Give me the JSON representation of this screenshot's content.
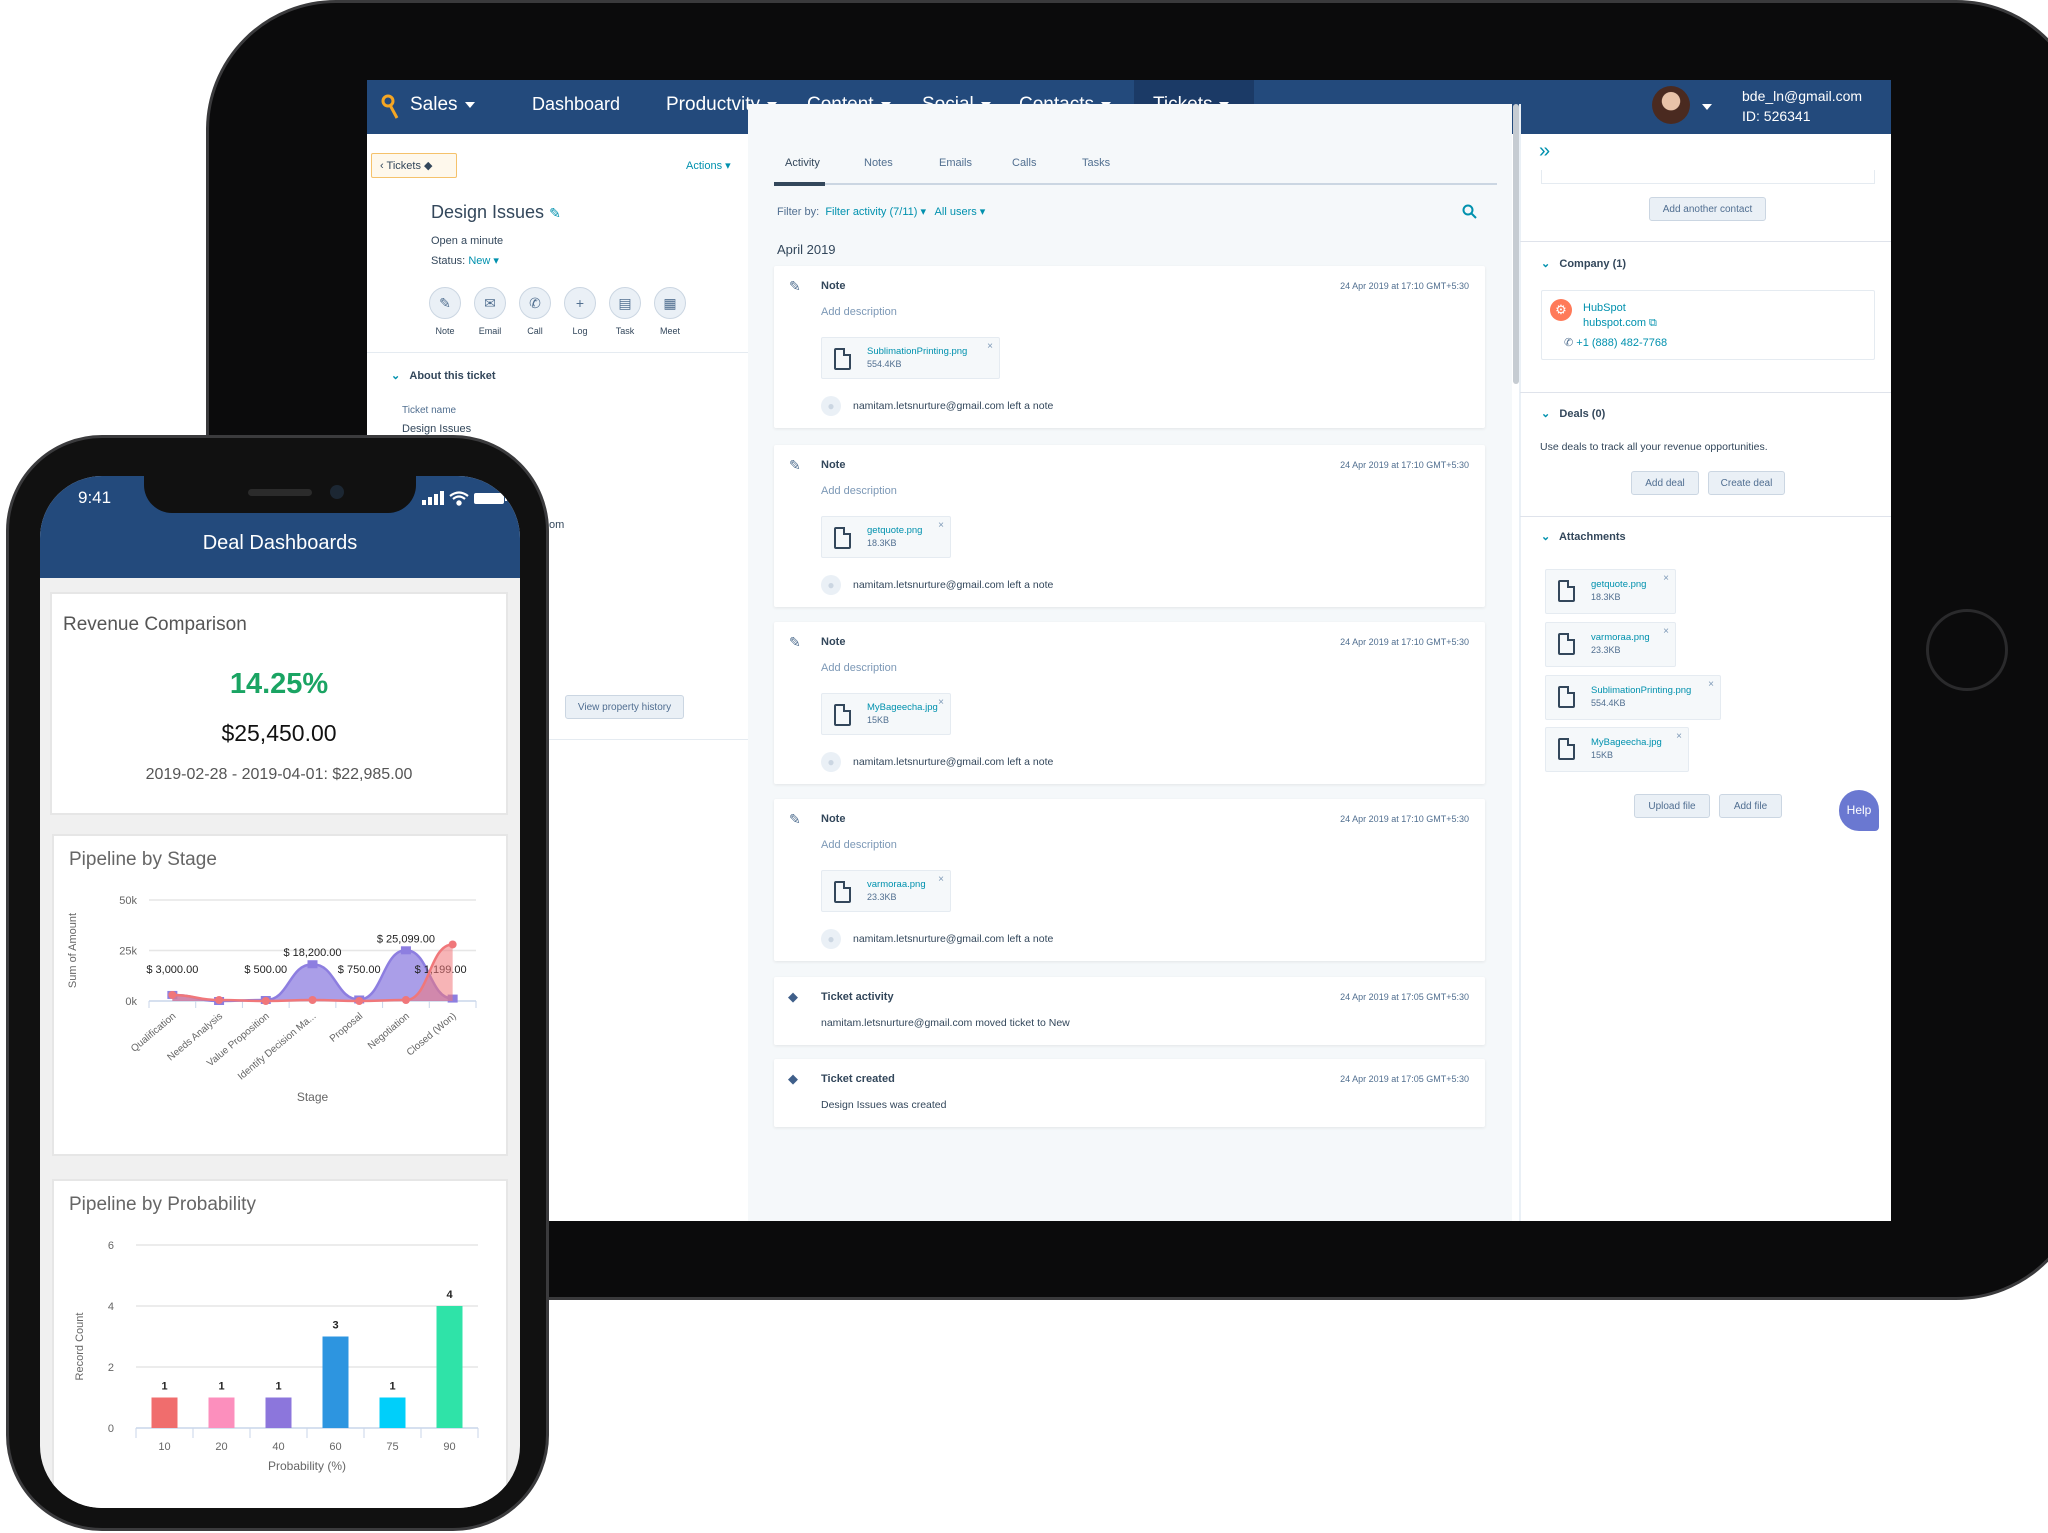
{
  "ipad": {
    "nav": {
      "app": "Sales",
      "items": [
        "Dashboard",
        "Productvity",
        "Content",
        "Social",
        "Contacts",
        "Tickets"
      ],
      "user_email": "bde_ln@gmail.com",
      "user_id": "ID: 526341",
      "brand_color": "#234a7c"
    },
    "left": {
      "breadcrumb": "Tickets",
      "actions": "Actions",
      "title": "Design Issues",
      "open": "Open a minute",
      "status_label": "Status:",
      "status_value": "New",
      "actions_row": [
        "Note",
        "Email",
        "Call",
        "Log",
        "Task",
        "Meet"
      ],
      "about": "About this ticket",
      "ticket_name_label": "Ticket name",
      "ticket_name_value": "Design Issues",
      "fragment": "om",
      "view_history": "View property history"
    },
    "middle": {
      "tabs": [
        "Activity",
        "Notes",
        "Emails",
        "Calls",
        "Tasks"
      ],
      "filter_label": "Filter by:",
      "filter_activity": "Filter activity (7/11)",
      "all_users": "All users",
      "month": "April 2019",
      "notes": [
        {
          "type": "Note",
          "time": "24 Apr 2019 at 17:10 GMT+5:30",
          "desc": "Add description",
          "file": "SublimationPrinting.png",
          "size": "554.4KB",
          "user": "namitam.letsnurture@gmail.com",
          "action": "left a note"
        },
        {
          "type": "Note",
          "time": "24 Apr 2019 at 17:10 GMT+5:30",
          "desc": "Add description",
          "file": "getquote.png",
          "size": "18.3KB",
          "user": "namitam.letsnurture@gmail.com",
          "action": "left a note"
        },
        {
          "type": "Note",
          "time": "24 Apr 2019 at 17:10 GMT+5:30",
          "desc": "Add description",
          "file": "MyBageecha.jpg",
          "size": "15KB",
          "user": "namitam.letsnurture@gmail.com",
          "action": "left a note"
        },
        {
          "type": "Note",
          "time": "24 Apr 2019 at 17:10 GMT+5:30",
          "desc": "Add description",
          "file": "varmoraa.png",
          "size": "23.3KB",
          "user": "namitam.letsnurture@gmail.com",
          "action": "left a note"
        }
      ],
      "events": [
        {
          "type": "Ticket activity",
          "time": "24 Apr 2019 at 17:05 GMT+5:30",
          "text": "namitam.letsnurture@gmail.com moved ticket to New"
        },
        {
          "type": "Ticket created",
          "time": "24 Apr 2019 at 17:05 GMT+5:30",
          "text": "Design Issues was created"
        }
      ]
    },
    "right": {
      "add_contact": "Add another contact",
      "company_header": "Company (1)",
      "company_name": "HubSpot",
      "company_domain": "hubspot.com",
      "company_phone": "+1 (888) 482-7768",
      "deals_header": "Deals (0)",
      "deals_text": "Use deals to track all your revenue opportunities.",
      "add_deal": "Add deal",
      "create_deal": "Create deal",
      "attachments_header": "Attachments",
      "attachments": [
        {
          "name": "getquote.png",
          "size": "18.3KB"
        },
        {
          "name": "varmoraa.png",
          "size": "23.3KB"
        },
        {
          "name": "SublimationPrinting.png",
          "size": "554.4KB"
        },
        {
          "name": "MyBageecha.jpg",
          "size": "15KB"
        }
      ],
      "upload_file": "Upload file",
      "add_file": "Add file",
      "help": "Help"
    }
  },
  "phone": {
    "time": "9:41",
    "title": "Deal Dashboards",
    "revenue": {
      "title": "Revenue Comparison",
      "percent": "14.25%",
      "amount": "$25,450.00",
      "previous": "2019-02-28 - 2019-04-01: $22,985.00",
      "percent_color": "#1aa463"
    },
    "stage_title": "Pipeline by Stage",
    "probability_title": "Pipeline by Probability"
  },
  "chart_data": [
    {
      "type": "area",
      "title": "Pipeline by Stage",
      "xlabel": "Stage",
      "ylabel": "Sum of Amount",
      "categories": [
        "Qualification",
        "Needs Analysis",
        "Value Proposition",
        "Identify Decision Ma...",
        "Proposal",
        "Negotiation",
        "Closed (Won)"
      ],
      "yticks": [
        "0k",
        "25k",
        "50k"
      ],
      "ylim": [
        0,
        50000
      ],
      "grid": true,
      "series": [
        {
          "color": "#8d7ee0",
          "values": [
            3000,
            0,
            500,
            18200,
            750,
            25099,
            1199
          ],
          "labels": [
            "$ 3,000.00",
            "",
            "$ 500.00",
            "$ 18,200.00",
            "$ 750.00",
            "$ 25,099.00",
            "$ 1,199.00"
          ]
        },
        {
          "color": "#f0777a",
          "values": [
            3000,
            500,
            0,
            500,
            0,
            500,
            28000
          ]
        }
      ]
    },
    {
      "type": "bar",
      "title": "Pipeline by Probability",
      "xlabel": "Probability (%)",
      "ylabel": "Record Count",
      "categories": [
        "10",
        "20",
        "40",
        "60",
        "75",
        "90"
      ],
      "values": [
        1,
        1,
        1,
        3,
        1,
        4
      ],
      "colors": [
        "#f06d6d",
        "#fc8fbd",
        "#8c76dc",
        "#2d95e0",
        "#00cffa",
        "#2fe3a8"
      ],
      "yticks": [
        "0",
        "2",
        "4",
        "6"
      ],
      "ylim": [
        0,
        6
      ],
      "grid": true
    }
  ]
}
